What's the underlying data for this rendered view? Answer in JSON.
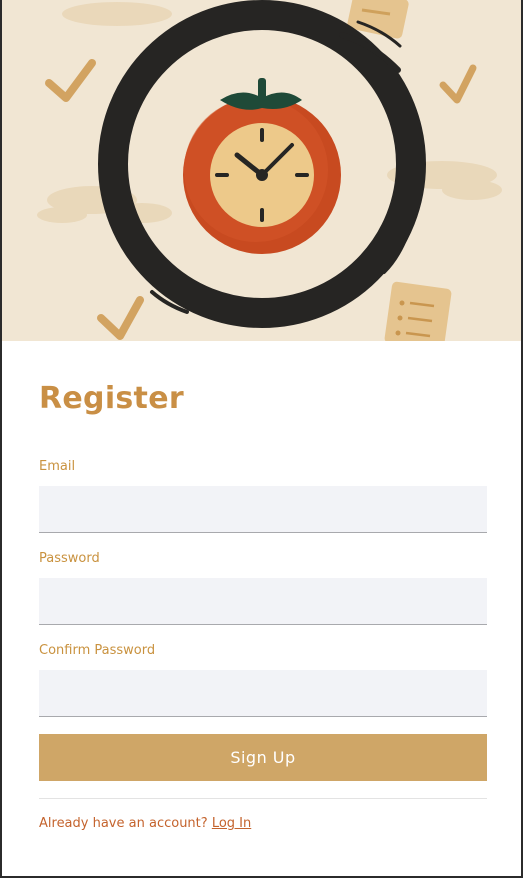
{
  "form": {
    "title": "Register",
    "email_label": "Email",
    "email_value": "",
    "password_label": "Password",
    "password_value": "",
    "confirm_label": "Confirm Password",
    "confirm_value": "",
    "submit_label": "Sign Up"
  },
  "footer": {
    "prompt": "Already have an account?",
    "login_link": "Log In"
  },
  "hero": {
    "icons": [
      "tomato-clock-icon",
      "brush-circle",
      "checkmark-icon",
      "note-icon"
    ]
  },
  "colors": {
    "accent": "#c98f45",
    "button": "#cfa667",
    "link": "#c4632d",
    "input_bg": "#f2f3f7",
    "hero_bg": "#f1e6d3"
  }
}
